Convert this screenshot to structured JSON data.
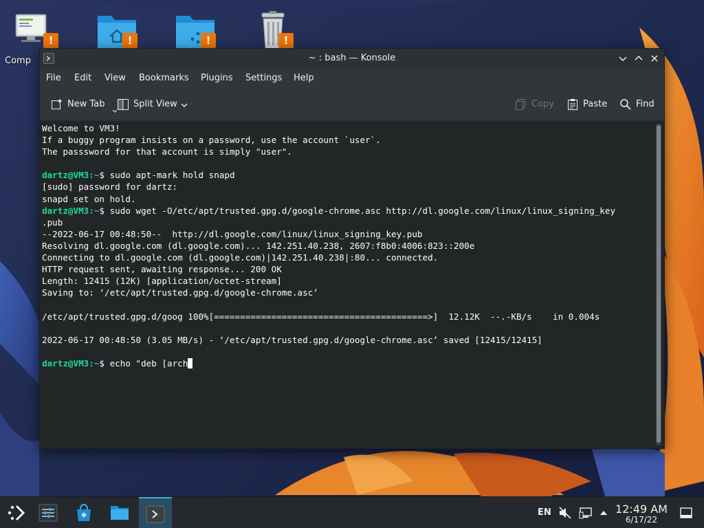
{
  "desktop": {
    "icons": [
      {
        "label": "Comp",
        "name": "computer-icon"
      },
      {
        "label": "",
        "name": "home-folder-icon"
      },
      {
        "label": "",
        "name": "network-folder-icon"
      },
      {
        "label": "",
        "name": "trash-icon"
      }
    ],
    "warning_glyph": "!"
  },
  "window": {
    "title": "~ : bash — Konsole",
    "menu": [
      "File",
      "Edit",
      "View",
      "Bookmarks",
      "Plugins",
      "Settings",
      "Help"
    ],
    "toolbar": {
      "new_tab": "New Tab",
      "split_view": "Split View",
      "copy": "Copy",
      "paste": "Paste",
      "find": "Find"
    }
  },
  "terminal": {
    "lines": [
      {
        "text": "Welcome to VM3!"
      },
      {
        "text": "If a buggy program insists on a password, use the account `user`."
      },
      {
        "text": "The passsword for that account is simply \"user\"."
      },
      {
        "text": ""
      },
      {
        "user": "dartz@VM3",
        "path": ":~",
        "text": "$ sudo apt-mark hold snapd"
      },
      {
        "text": "[sudo] password for dartz:"
      },
      {
        "text": "snapd set on hold."
      },
      {
        "user": "dartz@VM3",
        "path": ":~",
        "text": "$ sudo wget -O/etc/apt/trusted.gpg.d/google-chrome.asc http://dl.google.com/linux/linux_signing_key"
      },
      {
        "text": ".pub"
      },
      {
        "text": "--2022-06-17 00:48:50--  http://dl.google.com/linux/linux_signing_key.pub"
      },
      {
        "text": "Resolving dl.google.com (dl.google.com)... 142.251.40.238, 2607:f8b0:4006:823::200e"
      },
      {
        "text": "Connecting to dl.google.com (dl.google.com)|142.251.40.238|:80... connected."
      },
      {
        "text": "HTTP request sent, awaiting response... 200 OK"
      },
      {
        "text": "Length: 12415 (12K) [application/octet-stream]"
      },
      {
        "text": "Saving to: ‘/etc/apt/trusted.gpg.d/google-chrome.asc’"
      },
      {
        "text": ""
      },
      {
        "text": "/etc/apt/trusted.gpg.d/goog 100%[=========================================>]  12.12K  --.-KB/s    in 0.004s"
      },
      {
        "text": ""
      },
      {
        "text": "2022-06-17 00:48:50 (3.05 MB/s) - ‘/etc/apt/trusted.gpg.d/google-chrome.asc’ saved [12415/12415]"
      },
      {
        "text": ""
      },
      {
        "user": "dartz@VM3",
        "path": ":~",
        "text": "$ echo \"deb [arch",
        "cursor": true
      }
    ]
  },
  "taskbar": {
    "language": "EN",
    "time": "12:49 AM",
    "date": "6/17/22"
  },
  "colors": {
    "accent": "#3daee9",
    "prompt_user": "#1cdc9a",
    "warning": "#f0760a"
  }
}
